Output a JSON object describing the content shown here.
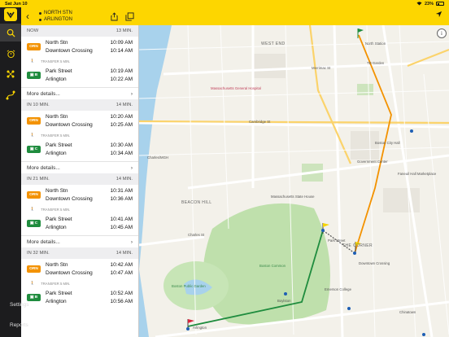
{
  "status_bar": {
    "time_date": "Sat Jun 10",
    "battery": "23%"
  },
  "header": {
    "origin": "NORTH STN",
    "destination": "ARLINGTON"
  },
  "rail": {
    "items": [
      {
        "name": "rail-home-icon"
      },
      {
        "name": "rail-alarm-icon"
      },
      {
        "name": "rail-network-icon"
      },
      {
        "name": "rail-route-icon"
      }
    ],
    "bottom_items": [
      "Settings",
      "Reports"
    ]
  },
  "trips": [
    {
      "when": "NOW",
      "duration": "13 MIN.",
      "leg1": {
        "line": "ORN",
        "from": "North Stn",
        "to": "Downtown Crossing",
        "dep": "10:09 AM",
        "arr": "10:14 AM"
      },
      "transfer": "TRANSFER 5 MIN.",
      "leg2": {
        "line": "B",
        "from": "Park Street",
        "to": "Arlington",
        "dep": "10:19 AM",
        "arr": "10:22 AM"
      },
      "details": "More details..."
    },
    {
      "when": "IN 10 MIN.",
      "duration": "14 MIN.",
      "leg1": {
        "line": "ORN",
        "from": "North Stn",
        "to": "Downtown Crossing",
        "dep": "10:20 AM",
        "arr": "10:25 AM"
      },
      "transfer": "TRANSFER 5 MIN.",
      "leg2": {
        "line": "C",
        "from": "Park Street",
        "to": "Arlington",
        "dep": "10:30 AM",
        "arr": "10:34 AM"
      },
      "details": "More details..."
    },
    {
      "when": "IN 21 MIN.",
      "duration": "14 MIN.",
      "leg1": {
        "line": "ORN",
        "from": "North Stn",
        "to": "Downtown Crossing",
        "dep": "10:31 AM",
        "arr": "10:36 AM"
      },
      "transfer": "TRANSFER 5 MIN.",
      "leg2": {
        "line": "C",
        "from": "Park Street",
        "to": "Arlington",
        "dep": "10:41 AM",
        "arr": "10:45 AM"
      },
      "details": "More details..."
    },
    {
      "when": "IN 32 MIN.",
      "duration": "14 MIN.",
      "leg1": {
        "line": "ORN",
        "from": "North Stn",
        "to": "Downtown Crossing",
        "dep": "10:42 AM",
        "arr": "10:47 AM"
      },
      "transfer": "TRANSFER 5 MIN.",
      "leg2": {
        "line": "B",
        "from": "Park Street",
        "to": "Arlington",
        "dep": "10:52 AM",
        "arr": "10:56 AM"
      },
      "details": "More details..."
    }
  ],
  "map": {
    "labels": {
      "cambridge_st": "Cambridge St",
      "beacon_hill": "BEACON HILL",
      "boston_common": "Boston Common",
      "public_garden": "Boston Public Garden",
      "state_house": "Massachusetts State House",
      "charles_mgh": "Charles/MGH",
      "mgh": "Massachusetts General Hospital",
      "government_center": "Government Center",
      "park_street": "Park Street",
      "downtown_crossing": "Downtown Crossing",
      "north_station": "North Station",
      "td_garden": "TD Garden",
      "city_hall": "Boston City Hall",
      "faneuil": "Faneuil Hall Marketplace",
      "emerson": "Emerson College",
      "chinatown": "Chinatown",
      "boylston": "Boylston",
      "arlington": "Arlington",
      "merrimac": "Merrimac St",
      "the_corner": "THE CORNER",
      "west_end": "WEST END",
      "charles_st": "Charles St"
    },
    "info_icon": "info-icon"
  }
}
